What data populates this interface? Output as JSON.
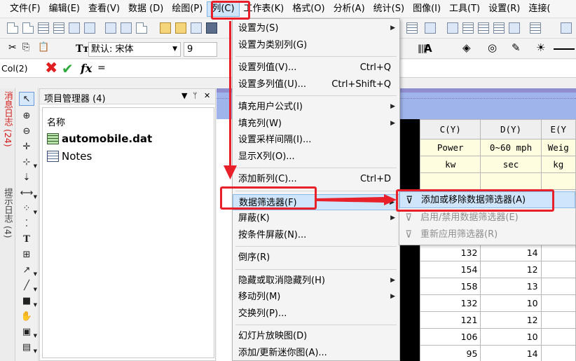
{
  "menubar": {
    "items": [
      "文件(F)",
      "编辑(E)",
      "查看(V)",
      "数据 (D)",
      "绘图(P)",
      "列(C)",
      "工作表(K)",
      "格式(O)",
      "分析(A)",
      "统计(S)",
      "图像(I)",
      "工具(T)",
      "设置(R)",
      "连接("
    ],
    "active_index": 5
  },
  "toolbar": {
    "font_name": "默认: 宋体",
    "font_size": "9"
  },
  "formula_bar": {
    "cell_ref": "Col(2)",
    "equals": "=",
    "fx": "fx"
  },
  "left_tabs": {
    "messages": "消息日志 (24)",
    "hints": "提示日志 (4)"
  },
  "project_manager": {
    "title": "项目管理器 (4)",
    "pin": "ᛘ",
    "close": "✕",
    "column_header": "名称",
    "items": [
      {
        "name": "automobile.dat",
        "type": "worksheet"
      },
      {
        "name": "Notes",
        "type": "notes"
      }
    ]
  },
  "column_menu": {
    "items": [
      {
        "label": "设置为(S)",
        "submenu": true
      },
      {
        "label": "设置为类别列(G)"
      },
      {
        "separator": true
      },
      {
        "label": "设置列值(V)...",
        "shortcut": "Ctrl+Q"
      },
      {
        "label": "设置多列值(U)...",
        "shortcut": "Ctrl+Shift+Q"
      },
      {
        "separator": true
      },
      {
        "label": "填充用户公式(I)",
        "submenu": true
      },
      {
        "label": "填充列(W)",
        "submenu": true
      },
      {
        "label": "设置采样间隔(I)..."
      },
      {
        "label": "显示X列(O)..."
      },
      {
        "separator": true
      },
      {
        "label": "添加新列(C)...",
        "shortcut": "Ctrl+D"
      },
      {
        "separator": true
      },
      {
        "label": "数据筛选器(F)",
        "submenu": true,
        "highlighted": true
      },
      {
        "label": "屏蔽(K)",
        "submenu": true
      },
      {
        "label": "按条件屏蔽(N)..."
      },
      {
        "separator": true
      },
      {
        "label": "倒序(R)"
      },
      {
        "separator": true
      },
      {
        "label": "隐藏或取消隐藏列(H)",
        "submenu": true
      },
      {
        "label": "移动列(M)",
        "submenu": true
      },
      {
        "label": "交换列(P)..."
      },
      {
        "separator": true
      },
      {
        "label": "幻灯片放映图(D)"
      },
      {
        "label": "添加/更新迷你图(A)..."
      }
    ]
  },
  "filter_submenu": {
    "items": [
      {
        "label": "添加或移除数据筛选器(A)",
        "enabled": true,
        "icon": "funnel-icon"
      },
      {
        "label": "启用/禁用数据筛选器(E)",
        "enabled": false,
        "icon": "funnel-toggle-icon"
      },
      {
        "label": "重新应用筛选器(R)",
        "enabled": false,
        "icon": "funnel-reapply-icon"
      }
    ]
  },
  "worksheet": {
    "headers": [
      "C(Y)",
      "D(Y)",
      "E(Y"
    ],
    "long_names": [
      "Power",
      "0~60 mph",
      "Weig"
    ],
    "units": [
      "kw",
      "sec",
      "kg"
    ],
    "rows": [
      [
        "132",
        "14",
        ""
      ],
      [
        "154",
        "12",
        ""
      ],
      [
        "158",
        "13",
        ""
      ],
      [
        "132",
        "10",
        ""
      ],
      [
        "121",
        "12",
        ""
      ],
      [
        "106",
        "10",
        ""
      ],
      [
        "95",
        "14",
        ""
      ]
    ]
  },
  "colors": {
    "highlight_red": "#e8202a",
    "menu_highlight": "#cfe5fb",
    "worksheet_title": "#9eb4ea",
    "label_yellow": "#fffde0"
  }
}
